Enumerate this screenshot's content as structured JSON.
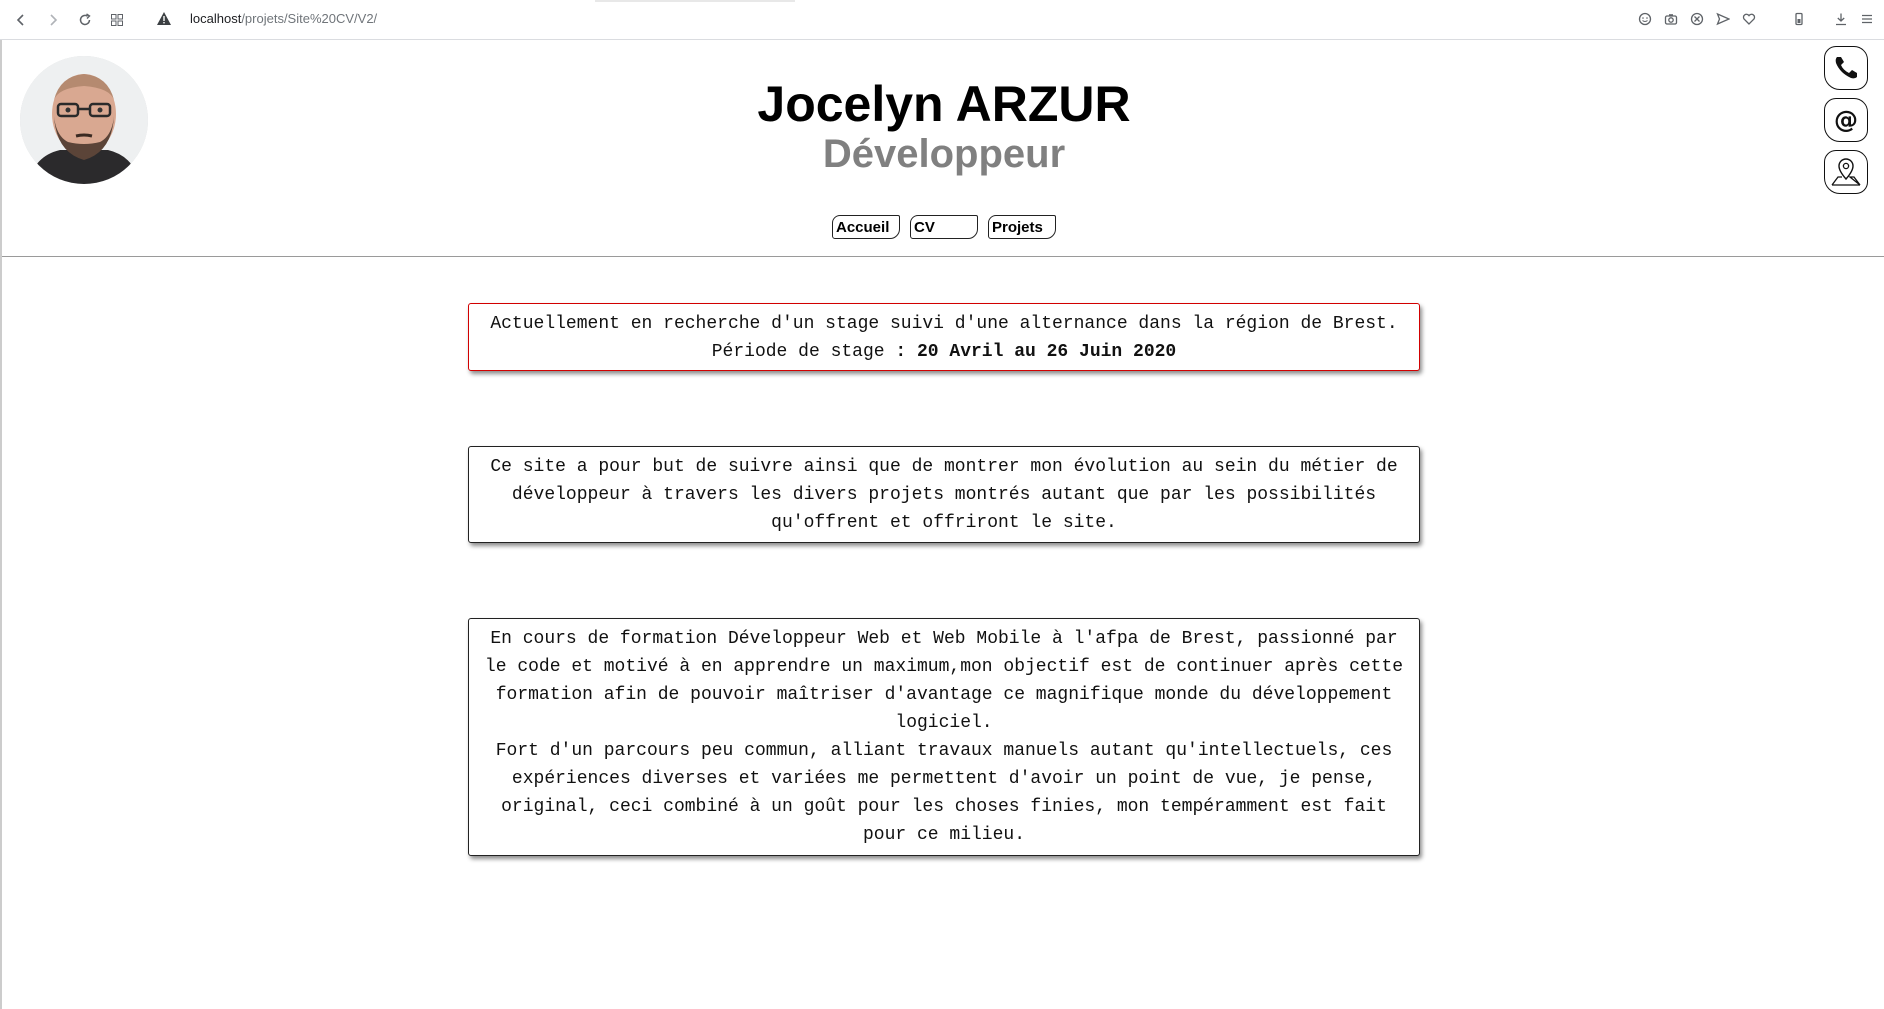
{
  "browser": {
    "url_host": "localhost",
    "url_path": "/projets/Site%20CV/V2/"
  },
  "header": {
    "name": "Jocelyn ARZUR",
    "role": "Développeur"
  },
  "nav": {
    "items": [
      "Accueil",
      "CV",
      "Projets"
    ]
  },
  "contact": {
    "icons": [
      "phone-icon",
      "at-icon",
      "map-pin-icon"
    ]
  },
  "cards": {
    "alert_line1": "Actuellement en recherche d'un stage suivi d'une alternance dans la région de Brest.",
    "alert_line2_label": "Période de stage",
    "alert_line2_value": ": 20 Avril au 26 Juin 2020",
    "purpose": "Ce site a pour but de suivre ainsi que de montrer mon évolution au sein du métier de développeur à travers les divers projets montrés autant que par les possibilités qu'offrent et offriront le site.",
    "about_p1": "En cours de formation Développeur Web et Web Mobile à l'afpa de Brest, passionné par le code et motivé à en apprendre un maximum,mon objectif est de continuer après cette formation afin de pouvoir maîtriser d'avantage ce magnifique monde du développement logiciel.",
    "about_p2": "Fort d'un parcours peu commun, alliant travaux manuels autant qu'intellectuels, ces expériences diverses et variées me permettent d'avoir un point de vue, je pense, original, ceci combiné à un goût pour les choses finies, mon tempéramment est fait pour ce milieu."
  },
  "colors": {
    "alert_border": "#d20000",
    "subtitle": "#808080"
  }
}
